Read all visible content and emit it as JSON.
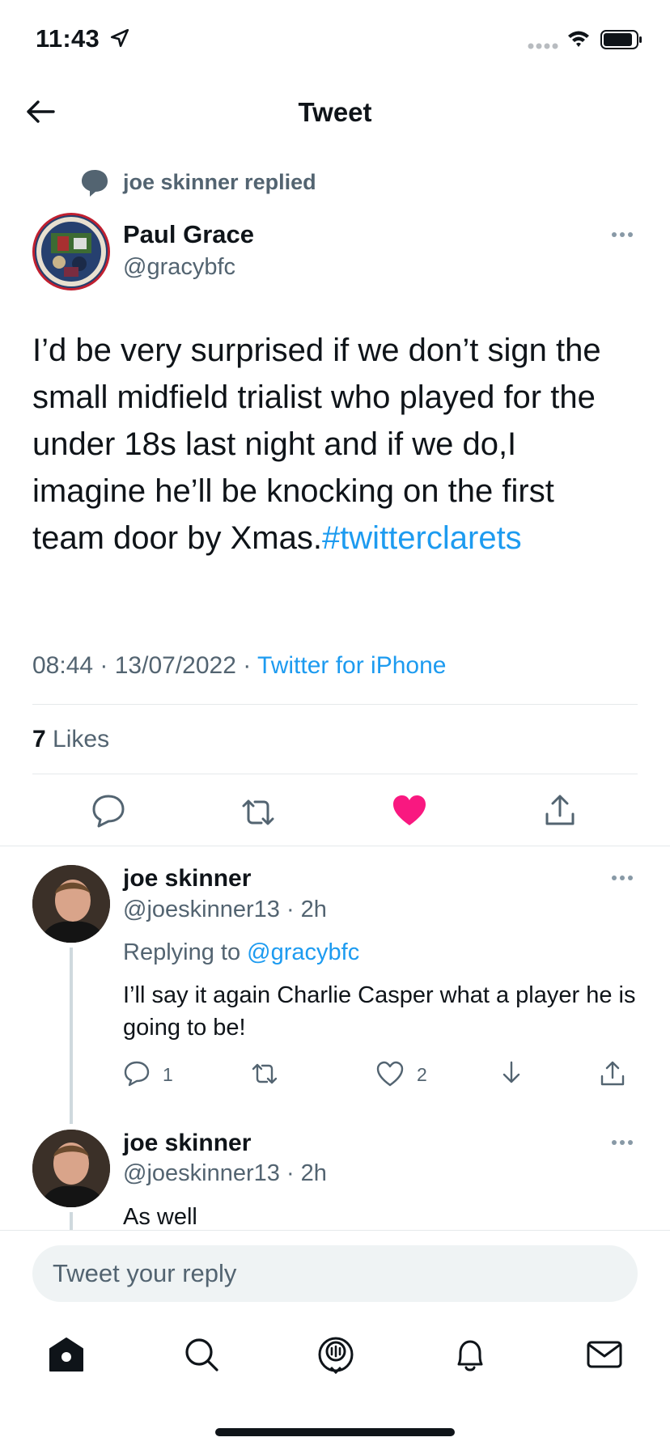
{
  "status_bar": {
    "time": "11:43"
  },
  "header": {
    "title": "Tweet"
  },
  "context": {
    "replied_text": "joe skinner replied"
  },
  "main_tweet": {
    "author_name": "Paul Grace",
    "author_handle": "@gracybfc",
    "text": "I’d be very surprised if we don’t sign the small midfield trialist who played for the under 18s last night and if we do,I imagine he’ll be knocking on the first team door by Xmas.",
    "hashtag": "#twitterclarets",
    "time": "08:44",
    "date": "13/07/2022",
    "source": "Twitter for iPhone",
    "likes_count": "7",
    "likes_label": "Likes",
    "liked": true,
    "like_color": "#f91880"
  },
  "replies": [
    {
      "name": "joe skinner",
      "handle": "@joeskinner13",
      "age": "2h",
      "replying_label": "Replying to",
      "replying_to": "@gracybfc",
      "text": "I’ll say it again Charlie Casper what a player he is going to be!",
      "reply_count": "1",
      "like_count": "2"
    },
    {
      "name": "joe skinner",
      "handle": "@joeskinner13",
      "age": "2h",
      "text": "As well"
    }
  ],
  "reply_bar": {
    "placeholder": "Tweet your reply"
  },
  "colors": {
    "accent": "#1d9bf0",
    "secondary_text": "#536471",
    "like": "#f91880"
  }
}
